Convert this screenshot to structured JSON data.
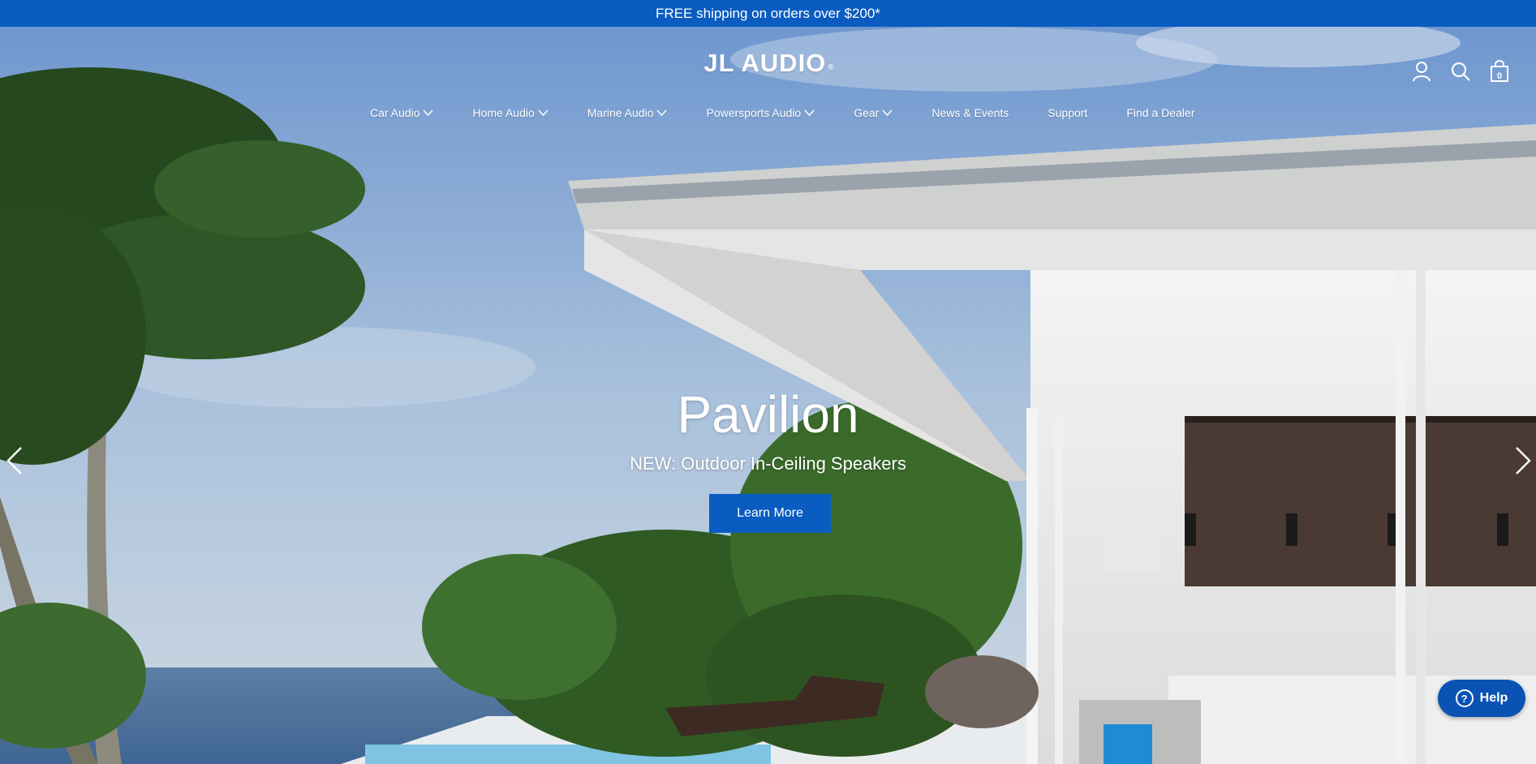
{
  "announcement": {
    "text": "FREE shipping on orders over $200*"
  },
  "header": {
    "logo_text": "JL AUDIO",
    "logo_reg": "®",
    "cart_count": "0"
  },
  "nav": {
    "items": [
      {
        "label": "Car Audio",
        "dropdown": true
      },
      {
        "label": "Home Audio",
        "dropdown": true
      },
      {
        "label": "Marine Audio",
        "dropdown": true
      },
      {
        "label": "Powersports Audio",
        "dropdown": true
      },
      {
        "label": "Gear",
        "dropdown": true
      },
      {
        "label": "News & Events",
        "dropdown": false
      },
      {
        "label": "Support",
        "dropdown": false
      },
      {
        "label": "Find a Dealer",
        "dropdown": false
      }
    ]
  },
  "hero": {
    "title": "Pavilion",
    "subtitle": "NEW: Outdoor In-Ceiling Speakers",
    "cta_label": "Learn More"
  },
  "help": {
    "label": "Help"
  },
  "icons": {
    "account": "user-icon",
    "search": "search-icon",
    "cart": "cart-icon",
    "prev": "chevron-left-icon",
    "next": "chevron-right-icon"
  },
  "colors": {
    "brand_blue": "#0a5cc0"
  }
}
